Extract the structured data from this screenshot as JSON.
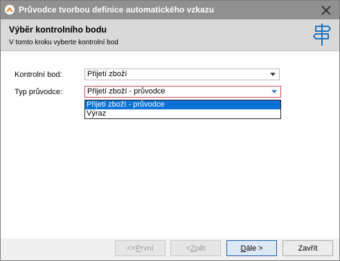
{
  "window": {
    "title": "Průvodce tvorbou definice automatického vzkazu",
    "close_icon": "close-icon",
    "app_icon": "app-logo-icon"
  },
  "header": {
    "title": "Výběr kontrolního bodu",
    "subtitle": "V tomto kroku vyberte kontrolní bod",
    "icon": "signpost-icon"
  },
  "form": {
    "checkpoint_label": "Kontrolní bod:",
    "checkpoint_value": "Přijetí zboží",
    "guide_type_label": "Typ průvodce:",
    "guide_type_value": "Přijetí zboží - průvodce",
    "guide_type_options": [
      "Přijetí zboží - průvodce",
      "Výraz"
    ],
    "guide_type_selected_index": 0
  },
  "buttons": {
    "first": {
      "prefix": "<< ",
      "mnemonic": "P",
      "rest": "rvní",
      "enabled": false
    },
    "back": {
      "prefix": "< ",
      "mnemonic": "Z",
      "rest": "pět",
      "enabled": false
    },
    "next": {
      "mnemonic": "D",
      "rest": "ále >",
      "enabled": true
    },
    "close": {
      "label": "Zavřít",
      "enabled": true
    }
  },
  "colors": {
    "titlebar": "#909090",
    "header_bg": "#d9d9d9",
    "accent": "#0a72d6",
    "icon_blue": "#1e73be",
    "active_border": "#c24b57"
  }
}
